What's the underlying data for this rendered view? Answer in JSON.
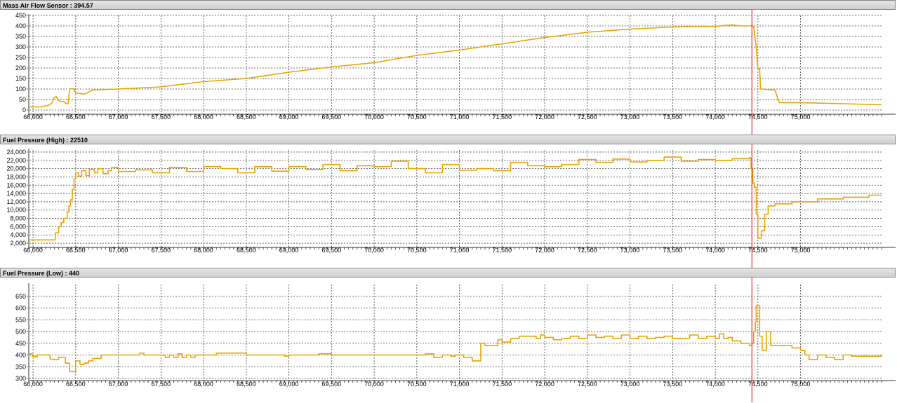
{
  "cursor": {
    "x": 74430,
    "color": "#e03030"
  },
  "line_color": "#e8a400",
  "chart_data": [
    {
      "type": "line",
      "title": "Mass Air Flow Sensor : 394.57",
      "xlim": [
        65950,
        75950
      ],
      "ylim": [
        -10,
        450
      ],
      "x_ticks": [
        66000,
        66500,
        67000,
        67500,
        68000,
        68500,
        69000,
        69500,
        70000,
        70500,
        71000,
        71500,
        72000,
        72500,
        73000,
        73500,
        74000,
        74500,
        75000
      ],
      "x_tick_labels": [
        "66,000",
        "66,500",
        "67,000",
        "67,500",
        "68,000",
        "68,500",
        "69,000",
        "69,500",
        "70,000",
        "70,500",
        "71,000",
        "71,500",
        "72,000",
        "72,500",
        "73,000",
        "73,500",
        "74,000",
        "74,500",
        "75,000"
      ],
      "y_ticks": [
        0,
        50,
        100,
        150,
        200,
        250,
        300,
        350,
        400,
        450
      ],
      "y_tick_labels": [
        "0",
        "50",
        "100",
        "150",
        "200",
        "250",
        "300",
        "350",
        "400",
        "450"
      ],
      "step": false,
      "series": [
        {
          "x": [
            65950,
            66100,
            66200,
            66230,
            66250,
            66270,
            66300,
            66330,
            66360,
            66390,
            66410,
            66430,
            66450,
            66480,
            66500,
            66550,
            66600,
            66700,
            67000,
            67500,
            68000,
            68500,
            69000,
            69500,
            70000,
            70500,
            71000,
            71500,
            72000,
            72500,
            73000,
            73500,
            74000,
            74100,
            74200,
            74300,
            74400,
            74430,
            74450,
            74480,
            74500,
            74520,
            74530,
            74560,
            74600,
            74700,
            74750,
            75000,
            75500,
            75950
          ],
          "y": [
            15,
            15,
            25,
            40,
            60,
            65,
            45,
            40,
            40,
            30,
            30,
            100,
            102,
            100,
            80,
            80,
            75,
            95,
            100,
            110,
            135,
            150,
            180,
            205,
            225,
            260,
            285,
            315,
            345,
            370,
            385,
            395,
            398,
            402,
            405,
            400,
            400,
            403,
            395,
            300,
            200,
            195,
            100,
            100,
            98,
            95,
            35,
            35,
            30,
            25
          ]
        }
      ]
    },
    {
      "type": "line",
      "title": "Fuel Pressure (High) : 22510",
      "xlim": [
        65950,
        75950
      ],
      "ylim": [
        1500,
        24500
      ],
      "x_ticks": [
        66000,
        66500,
        67000,
        67500,
        68000,
        68500,
        69000,
        69500,
        70000,
        70500,
        71000,
        71500,
        72000,
        72500,
        73000,
        73500,
        74000,
        74500,
        75000
      ],
      "x_tick_labels": [
        "66,000",
        "66,500",
        "67,000",
        "67,500",
        "68,000",
        "68,500",
        "69,000",
        "69,500",
        "70,000",
        "70,500",
        "71,000",
        "71,500",
        "72,000",
        "72,500",
        "73,000",
        "73,500",
        "74,000",
        "74,500",
        "75,000"
      ],
      "y_ticks": [
        2000,
        4000,
        6000,
        8000,
        10000,
        12000,
        14000,
        16000,
        18000,
        20000,
        22000,
        24000
      ],
      "y_tick_labels": [
        "2,000",
        "4,000",
        "6,000",
        "8,000",
        "10,000",
        "12,000",
        "14,000",
        "16,000",
        "18,000",
        "20,000",
        "22,000",
        "24,000"
      ],
      "step": true,
      "series": [
        {
          "x": [
            65950,
            66230,
            66260,
            66300,
            66330,
            66360,
            66400,
            66420,
            66440,
            66460,
            66480,
            66500,
            66530,
            66570,
            66620,
            66660,
            66720,
            66760,
            66820,
            66880,
            66920,
            67000,
            67200,
            67400,
            67600,
            67800,
            68000,
            68200,
            68400,
            68600,
            68800,
            69000,
            69200,
            69400,
            69600,
            69800,
            70000,
            70200,
            70400,
            70600,
            70800,
            71000,
            71200,
            71400,
            71600,
            71800,
            72000,
            72200,
            72400,
            72600,
            72800,
            73000,
            73200,
            73400,
            73600,
            73800,
            74000,
            74200,
            74400,
            74420,
            74440,
            74460,
            74480,
            74500,
            74540,
            74580,
            74620,
            74700,
            74900,
            75200,
            75500,
            75800,
            75950
          ],
          "y": [
            2800,
            2800,
            4500,
            6000,
            7000,
            8000,
            9500,
            11000,
            12500,
            15000,
            17500,
            19000,
            18200,
            19500,
            18300,
            19800,
            19000,
            20000,
            18800,
            19500,
            20300,
            19300,
            19700,
            19000,
            20300,
            19300,
            20500,
            20000,
            19000,
            20500,
            19400,
            20500,
            19800,
            21000,
            19500,
            20700,
            20500,
            21800,
            20000,
            19000,
            21000,
            19600,
            20000,
            19500,
            21500,
            20700,
            20500,
            21000,
            22200,
            21500,
            22300,
            21600,
            22000,
            22800,
            21800,
            22200,
            22000,
            22400,
            22600,
            20000,
            16500,
            15500,
            9000,
            3200,
            5000,
            9000,
            11000,
            11500,
            12000,
            12700,
            13100,
            13600,
            13600
          ]
        }
      ]
    },
    {
      "type": "line",
      "title": "Fuel Pressure (Low) : 440",
      "xlim": [
        65950,
        75950
      ],
      "ylim": [
        300,
        700
      ],
      "x_ticks": [
        66000,
        66500,
        67000,
        67500,
        68000,
        68500,
        69000,
        69500,
        70000,
        70500,
        71000,
        71500,
        72000,
        72500,
        73000,
        73500,
        74000,
        74500,
        75000
      ],
      "x_tick_labels": [
        "66,000",
        "66,500",
        "67,000",
        "67,500",
        "68,000",
        "68,500",
        "69,000",
        "69,500",
        "70,000",
        "70,500",
        "71,000",
        "71,500",
        "72,000",
        "72,500",
        "73,000",
        "73,500",
        "74,000",
        "74,500",
        "75,000"
      ],
      "y_ticks": [
        300,
        350,
        400,
        450,
        500,
        550,
        600,
        650
      ],
      "y_tick_labels": [
        "300",
        "350",
        "400",
        "450",
        "500",
        "550",
        "600",
        "650"
      ],
      "step": true,
      "series": [
        {
          "x": [
            65950,
            65990,
            66020,
            66050,
            66150,
            66200,
            66250,
            66300,
            66380,
            66430,
            66450,
            66500,
            66550,
            66600,
            66650,
            66700,
            66800,
            67000,
            67200,
            67250,
            67300,
            67500,
            67550,
            67600,
            67650,
            67700,
            67750,
            67800,
            67850,
            67900,
            68000,
            68100,
            68150,
            68500,
            68600,
            68700,
            68900,
            68950,
            69000,
            69300,
            69350,
            69500,
            70000,
            70500,
            70600,
            70700,
            70800,
            70900,
            70950,
            71050,
            71100,
            71150,
            71250,
            71300,
            71450,
            71500,
            71600,
            71700,
            71900,
            71950,
            72000,
            72100,
            72200,
            72300,
            72400,
            72500,
            72600,
            72700,
            72800,
            72900,
            73000,
            73100,
            73200,
            73300,
            73400,
            73500,
            73600,
            73700,
            73800,
            73900,
            74000,
            74050,
            74100,
            74150,
            74200,
            74300,
            74400,
            74430,
            74450,
            74470,
            74480,
            74500,
            74520,
            74550,
            74600,
            74620,
            74650,
            74700,
            74800,
            74900,
            75000,
            75050,
            75100,
            75200,
            75300,
            75400,
            75500,
            75600,
            75950
          ],
          "y": [
            405,
            395,
            392,
            400,
            400,
            382,
            380,
            390,
            365,
            330,
            330,
            375,
            360,
            365,
            375,
            385,
            400,
            400,
            400,
            408,
            400,
            400,
            390,
            400,
            390,
            405,
            390,
            400,
            390,
            400,
            400,
            400,
            408,
            400,
            400,
            400,
            400,
            395,
            400,
            400,
            405,
            400,
            400,
            400,
            405,
            390,
            400,
            395,
            400,
            390,
            390,
            375,
            450,
            440,
            465,
            455,
            470,
            480,
            470,
            485,
            475,
            465,
            470,
            480,
            470,
            485,
            475,
            480,
            470,
            485,
            470,
            480,
            470,
            475,
            480,
            470,
            470,
            485,
            470,
            480,
            470,
            490,
            470,
            475,
            460,
            450,
            440,
            450,
            500,
            540,
            610,
            610,
            480,
            420,
            500,
            500,
            440,
            440,
            440,
            430,
            420,
            400,
            380,
            400,
            390,
            380,
            400,
            395,
            400
          ]
        }
      ]
    }
  ]
}
